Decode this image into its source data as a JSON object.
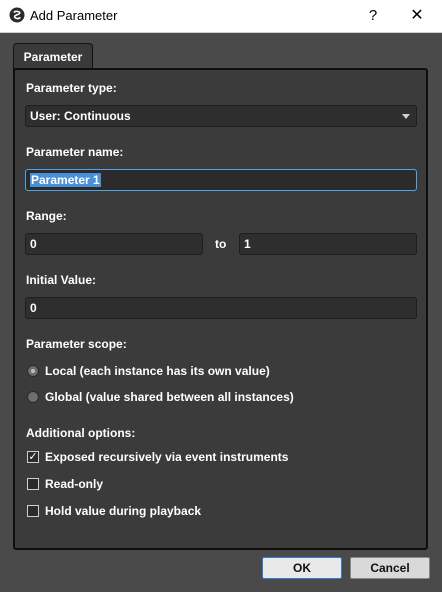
{
  "window": {
    "title": "Add Parameter",
    "help_label": "?",
    "close_label": "✕"
  },
  "tab": {
    "label": "Parameter"
  },
  "parameter_type": {
    "label": "Parameter type:",
    "value": "User: Continuous"
  },
  "parameter_name": {
    "label": "Parameter name:",
    "value": "Parameter 1"
  },
  "range": {
    "label": "Range:",
    "min": "0",
    "to_label": "to",
    "max": "1"
  },
  "initial_value": {
    "label": "Initial Value:",
    "value": "0"
  },
  "scope": {
    "label": "Parameter scope:",
    "options": [
      {
        "label": "Local (each instance has its own value)",
        "selected": true
      },
      {
        "label": "Global (value shared between all instances)",
        "selected": false
      }
    ]
  },
  "additional": {
    "label": "Additional options:",
    "options": [
      {
        "label": "Exposed recursively via event instruments",
        "checked": true
      },
      {
        "label": "Read-only",
        "checked": false
      },
      {
        "label": "Hold value during playback",
        "checked": false
      }
    ]
  },
  "buttons": {
    "ok": "OK",
    "cancel": "Cancel"
  },
  "colors": {
    "accent": "#4fa3e6",
    "panel": "#3b3b3b",
    "background": "#4a4a4a"
  }
}
